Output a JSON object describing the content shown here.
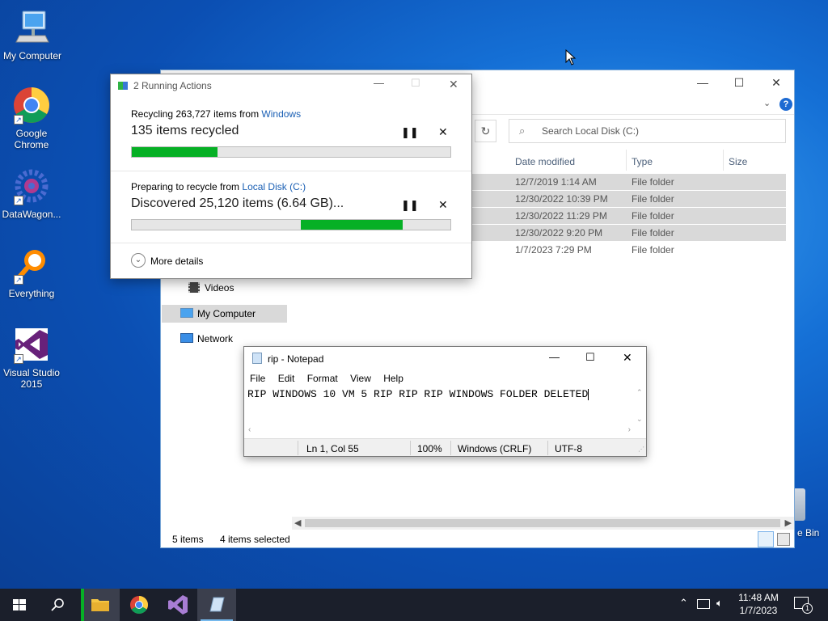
{
  "desktop": {
    "icons": [
      {
        "label": "My Computer",
        "icon": "computer-icon"
      },
      {
        "label": "Google\nChrome",
        "icon": "chrome-icon"
      },
      {
        "label": "DataWagon...",
        "icon": "datawagon-icon"
      },
      {
        "label": "Everything",
        "icon": "everything-icon"
      },
      {
        "label": "Visual Studio\n2015",
        "icon": "visual-studio-icon"
      }
    ],
    "recycle_bin_partial": "e Bin"
  },
  "explorer": {
    "search_placeholder": "Search Local Disk (C:)",
    "columns": {
      "date": "Date modified",
      "type": "Type",
      "size": "Size"
    },
    "rows": [
      {
        "date": "12/7/2019 1:14 AM",
        "type": "File folder",
        "selected": true
      },
      {
        "date": "12/30/2022 10:39 PM",
        "type": "File folder",
        "selected": true
      },
      {
        "date": "12/30/2022 11:29 PM",
        "type": "File folder",
        "selected": true
      },
      {
        "date": "12/30/2022 9:20 PM",
        "type": "File folder",
        "selected": true
      },
      {
        "date": "1/7/2023 7:29 PM",
        "type": "File folder",
        "selected": false
      }
    ],
    "nav": {
      "videos": "Videos",
      "my_computer": "My Computer",
      "network": "Network"
    },
    "status": {
      "items": "5 items",
      "selected": "4 items selected"
    },
    "help_glyph": "?"
  },
  "dialog": {
    "title": "2 Running Actions",
    "op1": {
      "line1_prefix": "Recycling 263,727 items from ",
      "line1_link": "Windows",
      "main": "135 items recycled",
      "progress": 0.27
    },
    "op2": {
      "line1_prefix": "Preparing to recycle from ",
      "line1_link": "Local Disk (C:)",
      "main": "Discovered 25,120 items (6.64 GB)...",
      "progress_start": 0.53,
      "progress_end": 0.85
    },
    "more_details": "More details"
  },
  "notepad": {
    "title": "rip - Notepad",
    "menu": [
      "File",
      "Edit",
      "Format",
      "View",
      "Help"
    ],
    "content": "RIP WINDOWS 10 VM 5 RIP RIP RIP WINDOWS FOLDER DELETED",
    "status": {
      "position": "Ln 1, Col 55",
      "zoom": "100%",
      "eol": "Windows (CRLF)",
      "encoding": "UTF-8"
    }
  },
  "taskbar": {
    "time": "11:48 AM",
    "date": "1/7/2023",
    "notification_count": "1"
  },
  "colors": {
    "accent": "#0078d7",
    "progress": "#06b025",
    "link": "#1a5fb4"
  }
}
